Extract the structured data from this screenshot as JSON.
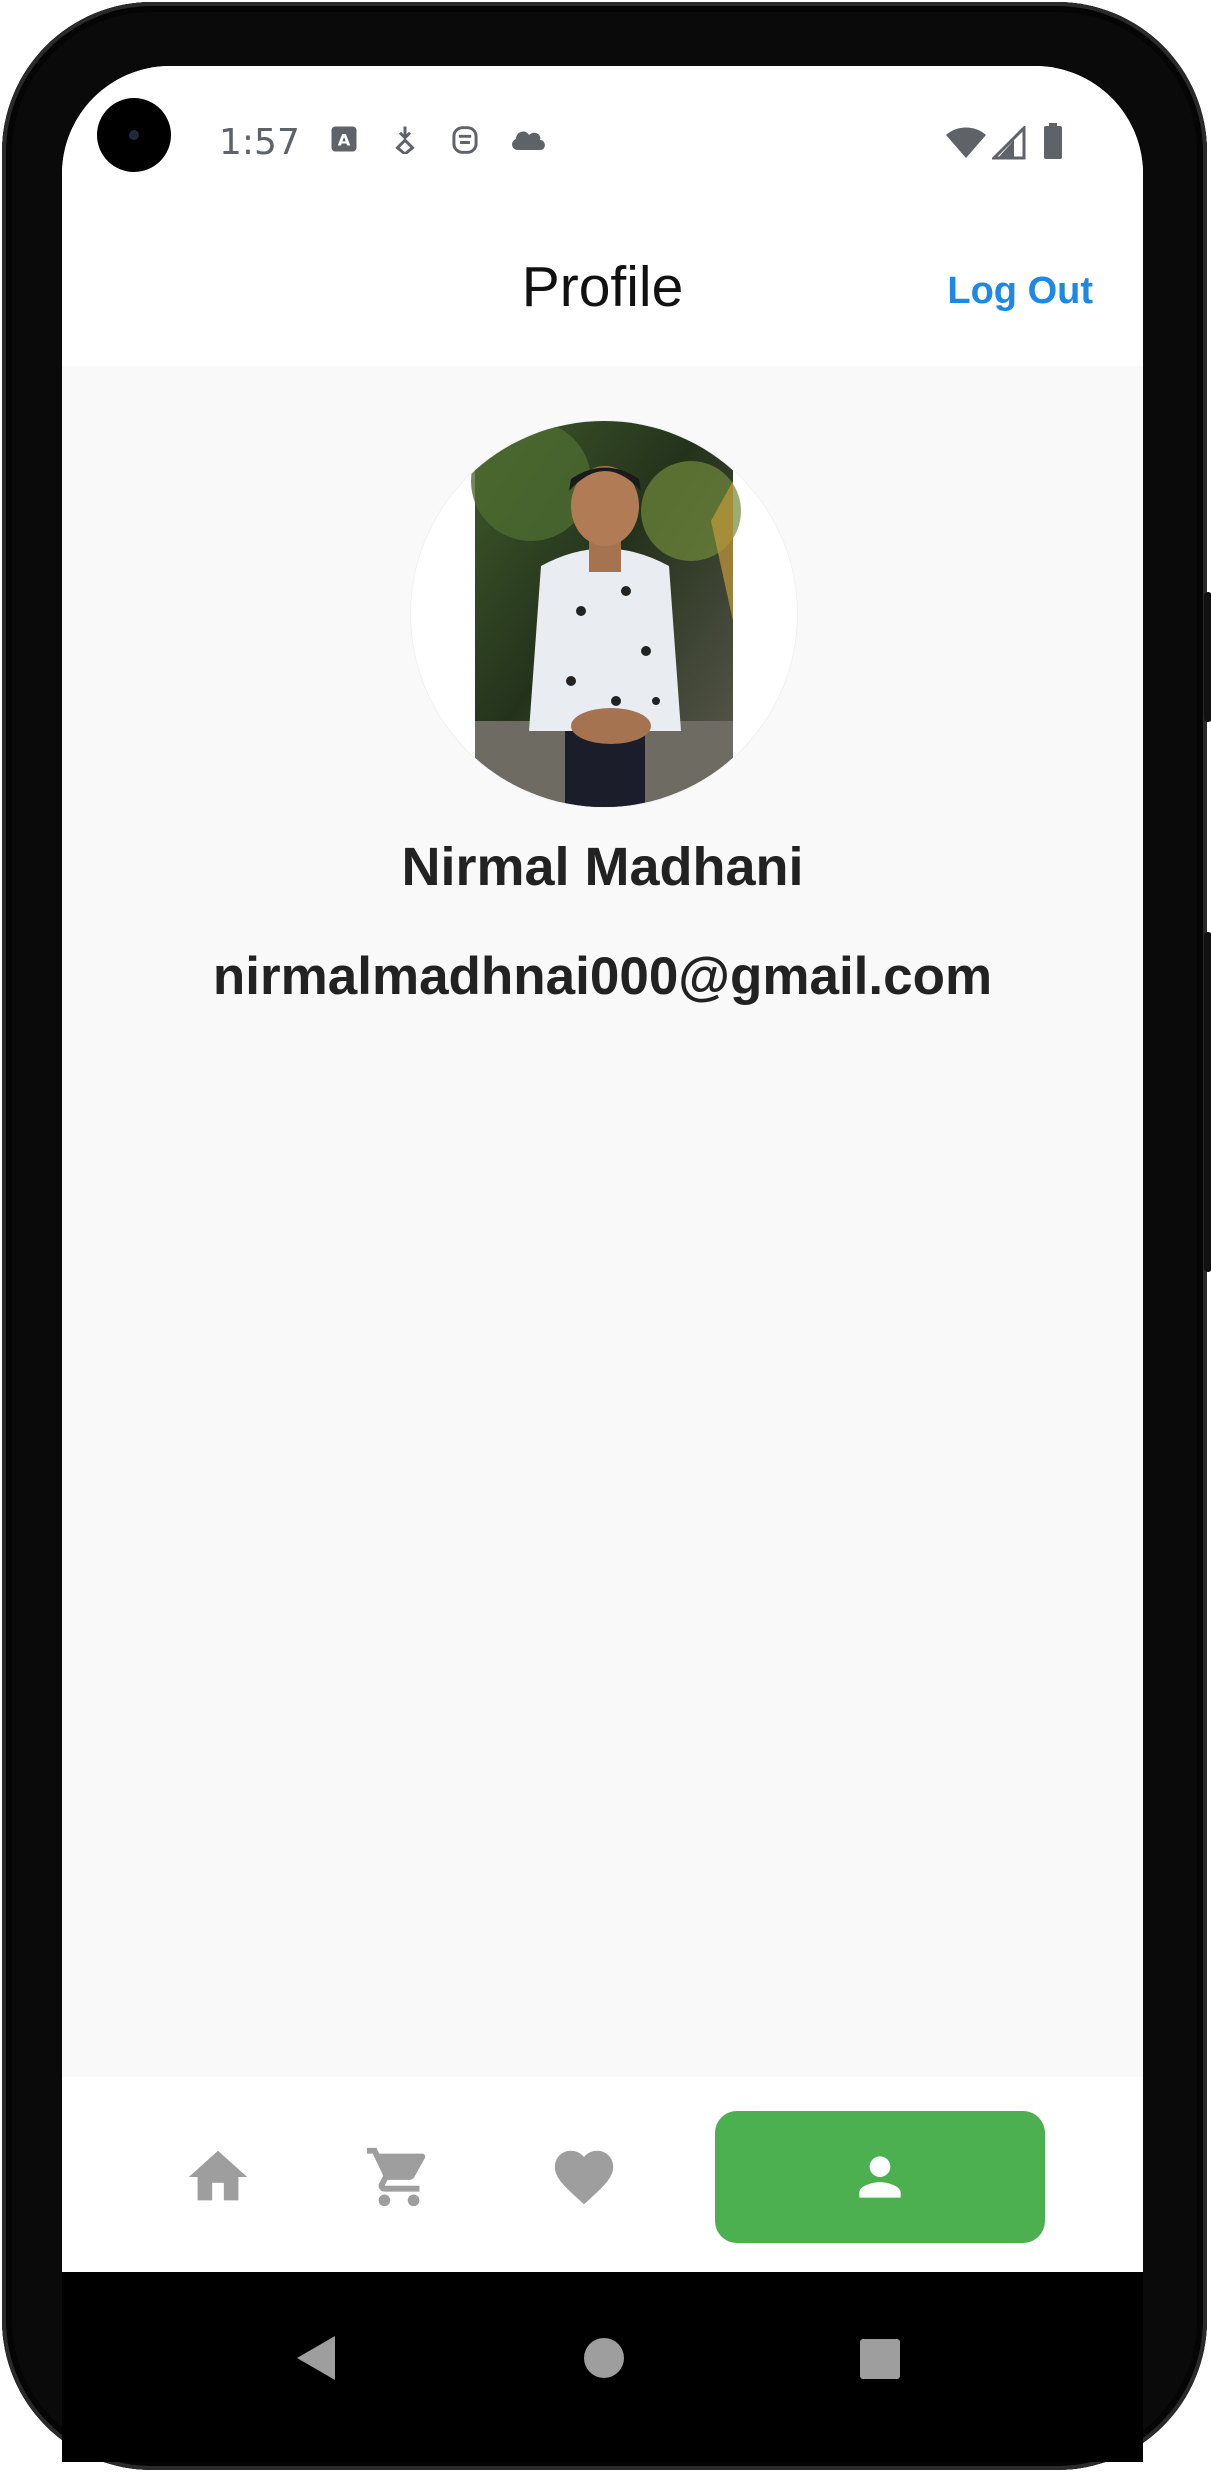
{
  "status_bar": {
    "time": "1:57",
    "left_icons": [
      "translate-icon",
      "location-download-icon",
      "bot-face-icon",
      "cloud-icon"
    ],
    "right_icons": [
      "wifi-icon",
      "cellular-signal-icon",
      "battery-icon"
    ]
  },
  "app_bar": {
    "title": "Profile",
    "logout_label": "Log Out",
    "logout_color": "#1e88e5"
  },
  "profile": {
    "name": "Nirmal Madhani",
    "email": "nirmalmadhnai000@gmail.com",
    "avatar": "profile-photo"
  },
  "bottom_nav": {
    "items": [
      {
        "icon": "home-icon",
        "active": false
      },
      {
        "icon": "cart-icon",
        "active": false
      },
      {
        "icon": "heart-icon",
        "active": false
      },
      {
        "icon": "person-icon",
        "active": true
      }
    ],
    "active_color": "#4caf50",
    "inactive_color": "#9e9e9e"
  },
  "system_nav": {
    "buttons": [
      "back-icon",
      "home-circle-icon",
      "recents-icon"
    ]
  }
}
